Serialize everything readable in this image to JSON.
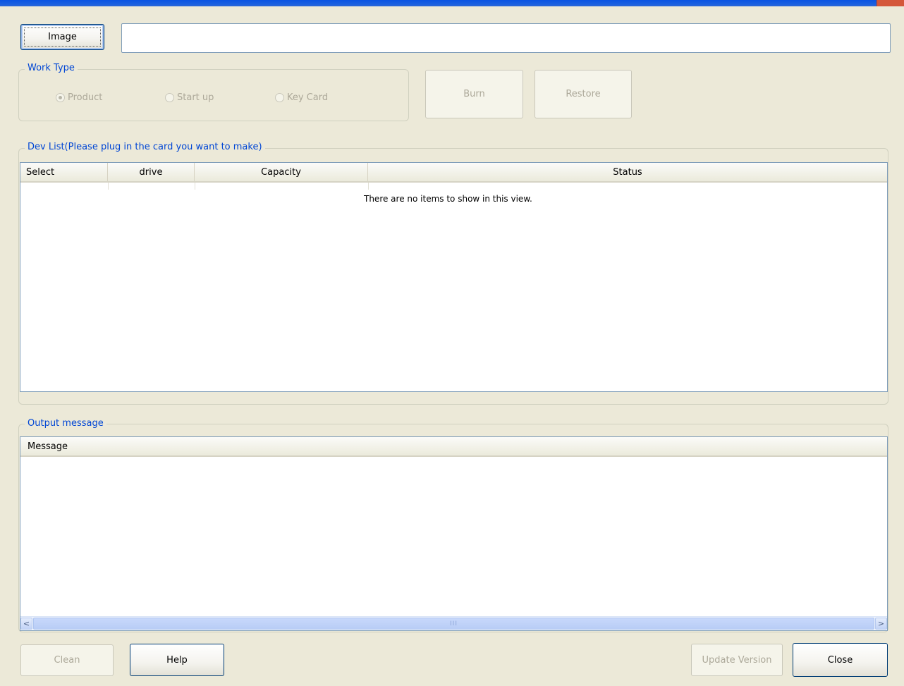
{
  "window": {
    "title": ""
  },
  "image": {
    "button_label": "Image",
    "path_value": ""
  },
  "work_type": {
    "title": "Work Type",
    "options": [
      {
        "label": "Product",
        "checked": true
      },
      {
        "label": "Start up",
        "checked": false
      },
      {
        "label": "Key Card",
        "checked": false
      }
    ]
  },
  "actions": {
    "burn_label": "Burn",
    "restore_label": "Restore"
  },
  "dev_list": {
    "title": "Dev List(Please plug in the card you want to make)",
    "columns": [
      "Select",
      "drive",
      "Capacity",
      "Status"
    ],
    "empty_text": "There are no items to show in this view."
  },
  "output": {
    "title": "Output message",
    "columns": [
      "Message"
    ],
    "scrollbar": {
      "left_arrow": "<",
      "right_arrow": ">",
      "grip": "III"
    }
  },
  "footer": {
    "clean_label": "Clean",
    "help_label": "Help",
    "update_label": "Update Version",
    "close_label": "Close"
  },
  "colors": {
    "group_title": "#0046d5",
    "background": "#ece9d8",
    "titlebar": "#0a54e3"
  }
}
